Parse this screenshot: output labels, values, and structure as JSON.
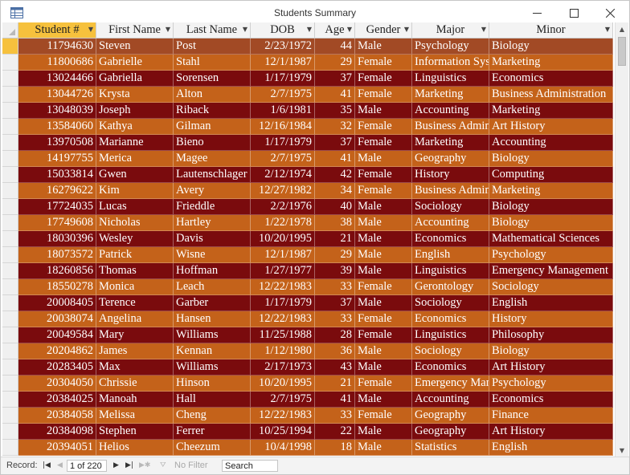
{
  "window": {
    "title": "Students Summary"
  },
  "columns": [
    {
      "label": "Student #",
      "key": "id",
      "align": "right"
    },
    {
      "label": "First Name",
      "key": "first",
      "align": "left"
    },
    {
      "label": "Last Name",
      "key": "last",
      "align": "left"
    },
    {
      "label": "DOB",
      "key": "dob",
      "align": "right"
    },
    {
      "label": "Age",
      "key": "age",
      "align": "right"
    },
    {
      "label": "Gender",
      "key": "gender",
      "align": "left"
    },
    {
      "label": "Major",
      "key": "major",
      "align": "left"
    },
    {
      "label": "Minor",
      "key": "minor",
      "align": "left"
    }
  ],
  "rows": [
    {
      "id": "11794630",
      "first": "Steven",
      "last": "Post",
      "dob": "2/23/1972",
      "age": "44",
      "gender": "Male",
      "major": "Psychology",
      "minor": "Biology"
    },
    {
      "id": "11800686",
      "first": "Gabrielle",
      "last": "Stahl",
      "dob": "12/1/1987",
      "age": "29",
      "gender": "Female",
      "major": "Information Systems",
      "minor": "Marketing"
    },
    {
      "id": "13024466",
      "first": "Gabriella",
      "last": "Sorensen",
      "dob": "1/17/1979",
      "age": "37",
      "gender": "Female",
      "major": "Linguistics",
      "minor": "Economics"
    },
    {
      "id": "13044726",
      "first": "Krysta",
      "last": "Alton",
      "dob": "2/7/1975",
      "age": "41",
      "gender": "Female",
      "major": "Marketing",
      "minor": "Business Administration"
    },
    {
      "id": "13048039",
      "first": "Joseph",
      "last": "Riback",
      "dob": "1/6/1981",
      "age": "35",
      "gender": "Male",
      "major": "Accounting",
      "minor": "Marketing"
    },
    {
      "id": "13584060",
      "first": "Kathya",
      "last": "Gilman",
      "dob": "12/16/1984",
      "age": "32",
      "gender": "Female",
      "major": "Business Administration",
      "minor": "Art History"
    },
    {
      "id": "13970508",
      "first": "Marianne",
      "last": "Bieno",
      "dob": "1/17/1979",
      "age": "37",
      "gender": "Female",
      "major": "Marketing",
      "minor": "Accounting"
    },
    {
      "id": "14197755",
      "first": "Merica",
      "last": "Magee",
      "dob": "2/7/1975",
      "age": "41",
      "gender": "Male",
      "major": "Geography",
      "minor": "Biology"
    },
    {
      "id": "15033814",
      "first": "Gwen",
      "last": "Lautenschlager",
      "dob": "2/12/1974",
      "age": "42",
      "gender": "Female",
      "major": "History",
      "minor": "Computing"
    },
    {
      "id": "16279622",
      "first": "Kim",
      "last": "Avery",
      "dob": "12/27/1982",
      "age": "34",
      "gender": "Female",
      "major": "Business Administration",
      "minor": "Marketing"
    },
    {
      "id": "17724035",
      "first": "Lucas",
      "last": "Frieddle",
      "dob": "2/2/1976",
      "age": "40",
      "gender": "Male",
      "major": "Sociology",
      "minor": "Biology"
    },
    {
      "id": "17749608",
      "first": "Nicholas",
      "last": "Hartley",
      "dob": "1/22/1978",
      "age": "38",
      "gender": "Male",
      "major": "Accounting",
      "minor": "Biology"
    },
    {
      "id": "18030396",
      "first": "Wesley",
      "last": "Davis",
      "dob": "10/20/1995",
      "age": "21",
      "gender": "Male",
      "major": "Economics",
      "minor": "Mathematical Sciences"
    },
    {
      "id": "18073572",
      "first": "Patrick",
      "last": "Wisne",
      "dob": "12/1/1987",
      "age": "29",
      "gender": "Male",
      "major": "English",
      "minor": "Psychology"
    },
    {
      "id": "18260856",
      "first": "Thomas",
      "last": "Hoffman",
      "dob": "1/27/1977",
      "age": "39",
      "gender": "Male",
      "major": "Linguistics",
      "minor": "Emergency Management"
    },
    {
      "id": "18550278",
      "first": "Monica",
      "last": "Leach",
      "dob": "12/22/1983",
      "age": "33",
      "gender": "Female",
      "major": "Gerontology",
      "minor": "Sociology"
    },
    {
      "id": "20008405",
      "first": "Terence",
      "last": "Garber",
      "dob": "1/17/1979",
      "age": "37",
      "gender": "Male",
      "major": "Sociology",
      "minor": "English"
    },
    {
      "id": "20038074",
      "first": "Angelina",
      "last": "Hansen",
      "dob": "12/22/1983",
      "age": "33",
      "gender": "Female",
      "major": "Economics",
      "minor": "History"
    },
    {
      "id": "20049584",
      "first": "Mary",
      "last": "Williams",
      "dob": "11/25/1988",
      "age": "28",
      "gender": "Female",
      "major": "Linguistics",
      "minor": "Philosophy"
    },
    {
      "id": "20204862",
      "first": "James",
      "last": "Kennan",
      "dob": "1/12/1980",
      "age": "36",
      "gender": "Male",
      "major": "Sociology",
      "minor": "Biology"
    },
    {
      "id": "20283405",
      "first": "Max",
      "last": "Williams",
      "dob": "2/17/1973",
      "age": "43",
      "gender": "Male",
      "major": "Economics",
      "minor": "Art History"
    },
    {
      "id": "20304050",
      "first": "Chrissie",
      "last": "Hinson",
      "dob": "10/20/1995",
      "age": "21",
      "gender": "Female",
      "major": "Emergency Management",
      "minor": "Psychology"
    },
    {
      "id": "20384025",
      "first": "Manoah",
      "last": "Hall",
      "dob": "2/7/1975",
      "age": "41",
      "gender": "Male",
      "major": "Accounting",
      "minor": "Economics"
    },
    {
      "id": "20384058",
      "first": "Melissa",
      "last": "Cheng",
      "dob": "12/22/1983",
      "age": "33",
      "gender": "Female",
      "major": "Geography",
      "minor": "Finance"
    },
    {
      "id": "20384098",
      "first": "Stephen",
      "last": "Ferrer",
      "dob": "10/25/1994",
      "age": "22",
      "gender": "Male",
      "major": "Geography",
      "minor": "Art History"
    },
    {
      "id": "20394051",
      "first": "Helios",
      "last": "Cheezum",
      "dob": "10/4/1998",
      "age": "18",
      "gender": "Male",
      "major": "Statistics",
      "minor": "English"
    }
  ],
  "statusbar": {
    "record_label": "Record:",
    "record_position": "1 of 220",
    "filter_label": "No Filter",
    "search_placeholder": "Search"
  },
  "colors": {
    "row_odd": "#c4621a",
    "row_even": "#7a0b0d",
    "row_first": "#a24a25",
    "header_active": "#f6c13d"
  }
}
